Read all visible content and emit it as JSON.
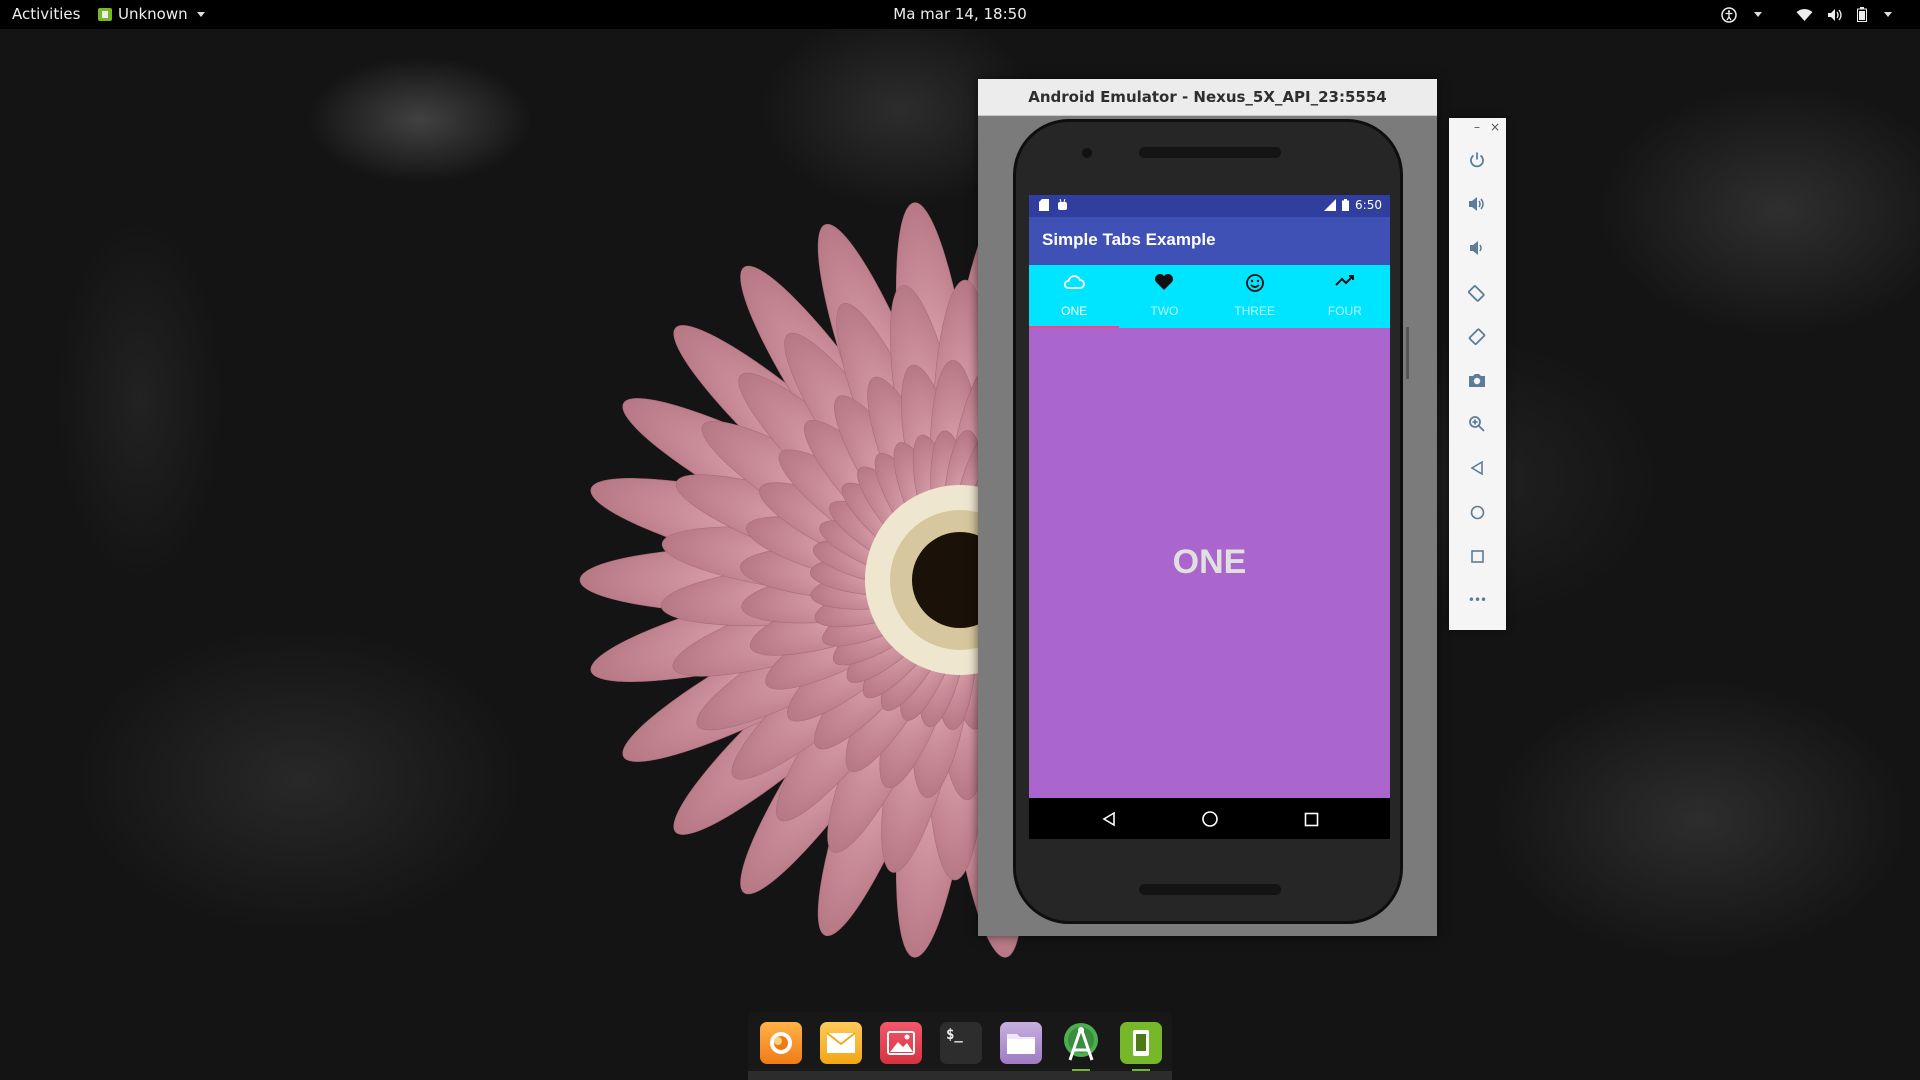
{
  "topbar": {
    "activities": "Activities",
    "app_menu": "Unknown",
    "clock": "Ma mar 14, 18:50",
    "tray_icons": [
      "accessibility-icon",
      "wifi-icon",
      "volume-icon",
      "battery-icon"
    ]
  },
  "emulator": {
    "title": "Android Emulator - Nexus_5X_API_23:5554",
    "status_time": "6:50",
    "app_title": "Simple Tabs Example",
    "tabs": [
      {
        "label": "ONE",
        "icon": "cloud-icon",
        "active": true
      },
      {
        "label": "TWO",
        "icon": "heart-icon",
        "active": false
      },
      {
        "label": "THREE",
        "icon": "smiley-icon",
        "active": false
      },
      {
        "label": "FOUR",
        "icon": "trending-up-icon",
        "active": false
      }
    ],
    "content_text": "ONE",
    "colors": {
      "status_bar": "#303f9f",
      "toolbar": "#3f51b5",
      "tab_bar": "#00e5ff",
      "tab_indicator": "#ff4081",
      "content": "#aa66cc"
    },
    "nav_buttons": [
      "back-icon",
      "home-icon",
      "recents-icon"
    ]
  },
  "emulator_controls": {
    "window_buttons": [
      "–",
      "×"
    ],
    "buttons": [
      "power-icon",
      "volume-up-icon",
      "volume-down-icon",
      "rotate-left-icon",
      "rotate-right-icon",
      "camera-icon",
      "zoom-icon",
      "back-icon",
      "home-icon",
      "overview-icon",
      "more-icon"
    ],
    "more_label": "•••"
  },
  "dock": {
    "apps": [
      "firefox-icon",
      "mail-icon",
      "photos-icon",
      "terminal-icon",
      "files-icon",
      "android-studio-icon",
      "emulator-icon"
    ],
    "terminal_label": "$_"
  }
}
